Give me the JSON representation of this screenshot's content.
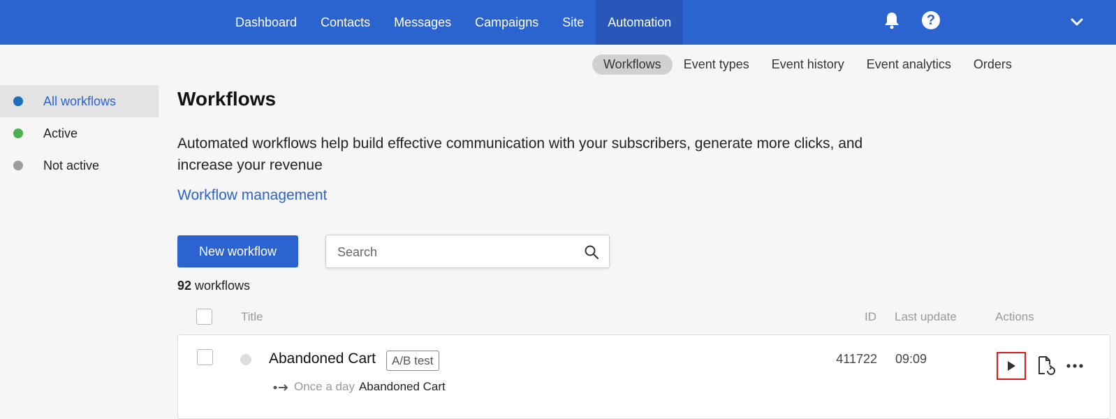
{
  "topnav": {
    "items": [
      {
        "label": "Dashboard"
      },
      {
        "label": "Contacts"
      },
      {
        "label": "Messages"
      },
      {
        "label": "Campaigns"
      },
      {
        "label": "Site"
      },
      {
        "label": "Automation",
        "active": true
      }
    ],
    "help_label": "?"
  },
  "subnav": {
    "items": [
      {
        "label": "Workflows",
        "active": true
      },
      {
        "label": "Event types"
      },
      {
        "label": "Event history"
      },
      {
        "label": "Event analytics"
      },
      {
        "label": "Orders"
      }
    ]
  },
  "sidebar": {
    "items": [
      {
        "label": "All workflows",
        "dot_color": "#1f6fbf",
        "active": true
      },
      {
        "label": "Active",
        "dot_color": "#4caf50"
      },
      {
        "label": "Not active",
        "dot_color": "#9e9e9e"
      }
    ]
  },
  "main": {
    "title": "Workflows",
    "description": "Automated workflows help build effective communication with your subscribers, generate more clicks, and increase your revenue",
    "link": "Workflow management",
    "new_button": "New workflow",
    "search_placeholder": "Search",
    "count_number": "92",
    "count_label": "workflows"
  },
  "table": {
    "headers": {
      "title": "Title",
      "id": "ID",
      "last_update": "Last update",
      "actions": "Actions"
    },
    "rows": [
      {
        "title": "Abandoned Cart",
        "badge": "A/B test",
        "frequency": "Once a day",
        "event": "Abandoned Cart",
        "id": "411722",
        "last_update": "09:09"
      }
    ]
  },
  "colors": {
    "accent": "#2b63cf",
    "highlight_border": "#e0161b"
  }
}
